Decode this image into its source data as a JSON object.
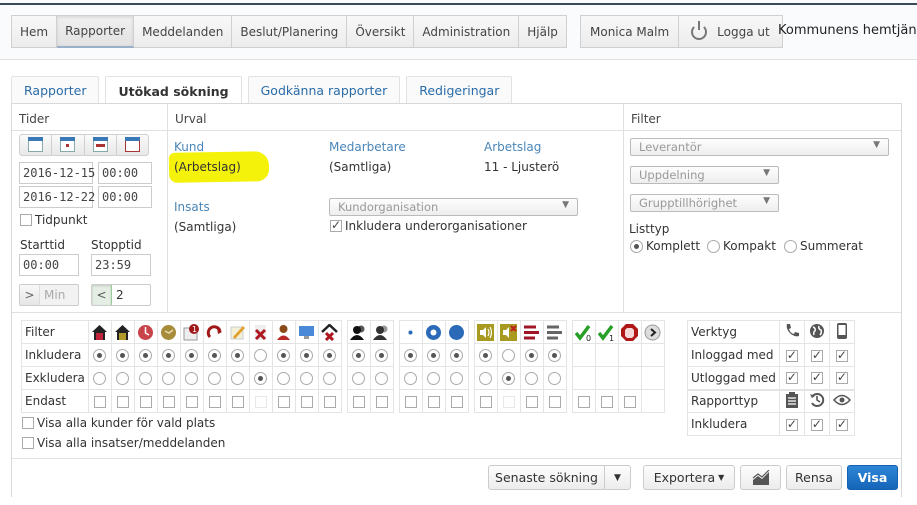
{
  "nav": {
    "items": [
      {
        "label": "Hem",
        "active": false
      },
      {
        "label": "Rapporter",
        "active": true
      },
      {
        "label": "Meddelanden",
        "active": false
      },
      {
        "label": "Beslut/Planering",
        "active": false
      },
      {
        "label": "Översikt",
        "active": false
      },
      {
        "label": "Administration",
        "active": false
      },
      {
        "label": "Hjälp",
        "active": false
      }
    ],
    "user": "Monica Malm",
    "logout": "Logga ut",
    "organization": "Kommunens hemtjänst"
  },
  "tabs": [
    {
      "label": "Rapporter",
      "active": false
    },
    {
      "label": "Utökad sökning",
      "active": true
    },
    {
      "label": "Godkänna rapporter",
      "active": false
    },
    {
      "label": "Redigeringar",
      "active": false
    }
  ],
  "tider": {
    "title": "Tider",
    "calendar_buttons": [
      "calendar-day-icon",
      "calendar-week-icon",
      "calendar-month-icon",
      "calendar-custom-icon"
    ],
    "from_date": "2016-12-15",
    "from_time": "00:00",
    "to_date": "2016-12-22",
    "to_time": "00:00",
    "tidpunkt_label": "Tidpunkt",
    "tidpunkt_checked": false,
    "starttid_label": "Starttid",
    "starttid": "00:00",
    "stopptid_label": "Stopptid",
    "stopptid": "23:59",
    "min_op": ">",
    "min_placeholder": "Min",
    "max_op": "<",
    "max_value": "2"
  },
  "urval": {
    "title": "Urval",
    "kund_label": "Kund",
    "kund_value": "(Arbetslag)",
    "medarbetare_label": "Medarbetare",
    "medarbetare_value": "(Samtliga)",
    "arbetslag_label": "Arbetslag",
    "arbetslag_value": "11 - Ljusterö",
    "insats_label": "Insats",
    "insats_value": "(Samtliga)",
    "kundorg_placeholder": "Kundorganisation",
    "include_sub_label": "Inkludera underorganisationer",
    "include_sub_checked": true
  },
  "filter": {
    "title": "Filter",
    "leverantor_placeholder": "Leverantör",
    "uppdelning_placeholder": "Uppdelning",
    "grupp_placeholder": "Grupptillhörighet",
    "listtyp_label": "Listtyp",
    "listtyp_options": [
      {
        "label": "Komplett",
        "selected": true
      },
      {
        "label": "Kompakt",
        "selected": false
      },
      {
        "label": "Summerat",
        "selected": false
      }
    ]
  },
  "matrix": {
    "row_labels": [
      "Filter",
      "Inkludera",
      "Exkludera",
      "Endast"
    ],
    "groups": [
      {
        "columns": [
          {
            "icon": "house-red-icon",
            "inkl": true,
            "exkl": false,
            "endast": "box"
          },
          {
            "icon": "house-yellow-icon",
            "inkl": true,
            "exkl": false,
            "endast": "box"
          },
          {
            "icon": "clock-red-icon",
            "inkl": true,
            "exkl": false,
            "endast": "box"
          },
          {
            "icon": "clock-gold-icon",
            "inkl": true,
            "exkl": false,
            "endast": "box"
          },
          {
            "icon": "message-badge-icon",
            "inkl": true,
            "exkl": false,
            "endast": "box"
          },
          {
            "icon": "redo-arrow-icon",
            "inkl": true,
            "exkl": false,
            "endast": "box"
          },
          {
            "icon": "edit-note-icon",
            "inkl": true,
            "exkl": false,
            "endast": "box"
          },
          {
            "icon": "delete-x-icon",
            "inkl": false,
            "exkl": true,
            "endast": "faint"
          },
          {
            "icon": "female-user-icon",
            "inkl": true,
            "exkl": false,
            "endast": "box"
          },
          {
            "icon": "monitor-icon",
            "inkl": true,
            "exkl": false,
            "endast": "box"
          },
          {
            "icon": "house-delete-icon",
            "inkl": true,
            "exkl": false,
            "endast": "box"
          }
        ]
      },
      {
        "columns": [
          {
            "icon": "users-black-icon",
            "inkl": true,
            "exkl": false,
            "endast": "box"
          },
          {
            "icon": "users-gray-icon",
            "inkl": true,
            "exkl": false,
            "endast": "box"
          }
        ]
      },
      {
        "columns": [
          {
            "icon": "dot-small-icon",
            "inkl": true,
            "exkl": false,
            "endast": "box"
          },
          {
            "icon": "ring-blue-icon",
            "inkl": true,
            "exkl": false,
            "endast": "box"
          },
          {
            "icon": "circle-blue-icon",
            "inkl": true,
            "exkl": false,
            "endast": "box"
          }
        ]
      },
      {
        "columns": [
          {
            "icon": "sound-on-icon",
            "inkl": true,
            "exkl": false,
            "endast": "box"
          },
          {
            "icon": "sound-off-icon",
            "inkl": false,
            "exkl": true,
            "endast": "faint"
          },
          {
            "icon": "lines-red-icon",
            "inkl": true,
            "exkl": false,
            "endast": "box"
          },
          {
            "icon": "lines-gray-icon",
            "inkl": true,
            "exkl": false,
            "endast": "box"
          }
        ]
      },
      {
        "columns": [
          {
            "icon": "check-0-icon",
            "inkl": null,
            "exkl": null,
            "endast": "box"
          },
          {
            "icon": "check-1-icon",
            "inkl": null,
            "exkl": null,
            "endast": "box"
          },
          {
            "icon": "stop-hand-icon",
            "inkl": null,
            "exkl": null,
            "endast": "box"
          },
          {
            "icon": "next-arrow-icon",
            "inkl": null,
            "exkl": null,
            "endast": "none"
          }
        ]
      }
    ],
    "visa_alla_kunder": "Visa alla kunder för vald plats",
    "visa_alla_insatser": "Visa alla insatser/meddelanden"
  },
  "verktyg": {
    "header": "Verktyg",
    "icons": [
      "phone-icon",
      "globe-icon",
      "mobile-icon"
    ],
    "rows": [
      {
        "label": "Inloggad med",
        "values": [
          true,
          true,
          true
        ]
      },
      {
        "label": "Utloggad med",
        "values": [
          true,
          true,
          true
        ]
      }
    ],
    "rapporttyp_label": "Rapporttyp",
    "rapporttyp_icons": [
      "clipboard-icon",
      "history-icon",
      "eye-icon"
    ],
    "inkludera_label": "Inkludera",
    "inkludera_values": [
      true,
      true,
      true
    ]
  },
  "footer": {
    "senaste": "Senaste sökning",
    "exportera": "Exportera",
    "rensa": "Rensa",
    "visa": "Visa"
  },
  "colors": {
    "accent": "#1565b8",
    "link": "#4a86b8",
    "highlight": "#f4f20a"
  }
}
